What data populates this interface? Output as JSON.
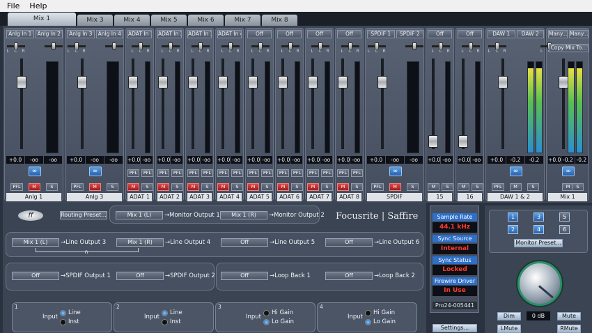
{
  "menu": {
    "file": "File",
    "help": "Help"
  },
  "tabs": [
    "Mix 1",
    "Mix 3",
    "Mix 4",
    "Mix 5",
    "Mix 6",
    "Mix 7",
    "Mix 8"
  ],
  "strips": [
    {
      "inputs": [
        "Anlg In 1",
        "Anlg In 2"
      ],
      "values": [
        "+0.0",
        "-oo",
        "-oo"
      ],
      "name": "Anlg 1"
    },
    {
      "inputs": [
        "Anlg In 3",
        "Anlg In 4"
      ],
      "values": [
        "+0.0",
        "-oo",
        "-oo"
      ],
      "name": "Anlg 3"
    },
    {
      "inputs": [
        "ADAT In 1"
      ],
      "values": [
        "+0.0",
        "-oo"
      ],
      "name": "ADAT 1"
    },
    {
      "inputs": [
        "ADAT In 2"
      ],
      "values": [
        "+0.0",
        "-oo"
      ],
      "name": "ADAT 2"
    },
    {
      "inputs": [
        "ADAT In 3"
      ],
      "values": [
        "+0.0",
        "-oo"
      ],
      "name": "ADAT 3"
    },
    {
      "inputs": [
        "ADAT In 4"
      ],
      "values": [
        "+0.0",
        "-oo"
      ],
      "name": "ADAT 4"
    },
    {
      "inputs": [
        "Off"
      ],
      "values": [
        "+0.0",
        "-oo"
      ],
      "name": "ADAT 5"
    },
    {
      "inputs": [
        "Off"
      ],
      "values": [
        "+0.0",
        "-oo"
      ],
      "name": "ADAT 6"
    },
    {
      "inputs": [
        "Off"
      ],
      "values": [
        "+0.0",
        "-oo"
      ],
      "name": "ADAT 7"
    },
    {
      "inputs": [
        "Off"
      ],
      "values": [
        "+0.0",
        "-oo"
      ],
      "name": "ADAT 8"
    },
    {
      "inputs": [
        "SPDIF 1",
        "SPDIF 2"
      ],
      "values": [
        "+0.0",
        "-oo",
        "-oo"
      ],
      "name": "SPDIF"
    },
    {
      "inputs": [
        "Off"
      ],
      "values": [
        "+0.0",
        "-oo"
      ],
      "name": "15"
    },
    {
      "inputs": [
        "Off"
      ],
      "values": [
        "+0.0",
        "-oo"
      ],
      "name": "16"
    },
    {
      "inputs": [
        "DAW 1",
        "DAW 2"
      ],
      "values": [
        "+0.0",
        "-0.2",
        "-0.2"
      ],
      "name": "DAW 1 & 2"
    },
    {
      "inputs": [
        "Many...",
        "Many..."
      ],
      "values": [
        "+0.0",
        "-0.2",
        "-0.2"
      ],
      "name": "Mix 1"
    }
  ],
  "copy_mix": "Copy Mix To...",
  "pfl": "PFL",
  "mute": "M",
  "solo": "S",
  "routing": {
    "preset": "Routing Preset...",
    "brand": "Focusrite | Saffire",
    "rows": [
      {
        "a": "Mix 1 (L)",
        "a_out": "→Monitor Output 1",
        "b": "Mix 1 (R)",
        "b_out": "→Monitor Output 2"
      },
      {
        "a": "Mix 1 (L)",
        "a_out": "→Line Output 3",
        "b": "Mix 1 (R)",
        "b_out": "→Line Output 4",
        "c": "Off",
        "c_out": "→Line Output 5",
        "d": "Off",
        "d_out": "→Line Output 6"
      },
      {
        "a": "Off",
        "a_out": "→SPDIF Output 1",
        "b": "Off",
        "b_out": "→SPDIF Output 2",
        "c": "Off",
        "c_out": "→Loop Back 1",
        "d": "Off",
        "d_out": "→Loop Back 2"
      }
    ]
  },
  "inputs": [
    {
      "num": "1",
      "label": "Input",
      "opt1": "Line",
      "opt2": "Inst"
    },
    {
      "num": "2",
      "label": "Input",
      "opt1": "Line",
      "opt2": "Inst"
    },
    {
      "num": "3",
      "label": "Input",
      "opt1": "Hi Gain",
      "opt2": "Lo Gain"
    },
    {
      "num": "4",
      "label": "Input",
      "opt1": "Hi Gain",
      "opt2": "Lo Gain"
    }
  ],
  "status": {
    "sample_rate_label": "Sample Rate",
    "sample_rate": "44.1 kHz",
    "sync_source_label": "Sync Source",
    "sync_source": "Internal",
    "sync_status_label": "Sync Status",
    "sync_status": "Locked",
    "firewire_label": "Firewire Driver",
    "firewire": "In Use",
    "device": "Pro24-005441",
    "settings": "Settings..."
  },
  "monitor": {
    "nums": [
      "1",
      "3",
      "5",
      "2",
      "4",
      "6"
    ],
    "preset": "Monitor Preset...",
    "db": "0 dB",
    "dim": "Dim",
    "mute": "Mute",
    "lmute": "LMute",
    "rmute": "RMute"
  }
}
